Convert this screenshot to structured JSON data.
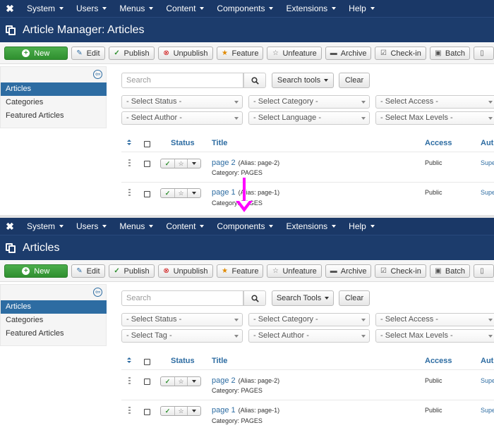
{
  "nav": {
    "items": [
      "System",
      "Users",
      "Menus",
      "Content",
      "Components",
      "Extensions",
      "Help"
    ]
  },
  "top": {
    "title": "Article Manager: Articles",
    "search": {
      "placeholder": "Search",
      "tools_label": "Search tools",
      "clear_label": "Clear"
    },
    "filters": [
      "- Select Status -",
      "- Select Category -",
      "- Select Access -",
      "- Select Author -",
      "- Select Language -",
      "- Select Max Levels -"
    ]
  },
  "bottom": {
    "title": "Articles",
    "search": {
      "placeholder": "Search",
      "tools_label": "Search Tools",
      "clear_label": "Clear"
    },
    "filters": [
      "- Select Status -",
      "- Select Category -",
      "- Select Access -",
      "- Select Tag -",
      "- Select Author -",
      "- Select Max Levels -"
    ]
  },
  "toolbar": {
    "new": "New",
    "edit": "Edit",
    "publish": "Publish",
    "unpublish": "Unpublish",
    "feature": "Feature",
    "unfeature": "Unfeature",
    "archive": "Archive",
    "checkin": "Check-in",
    "batch": "Batch"
  },
  "sidebar": {
    "items": [
      "Articles",
      "Categories",
      "Featured Articles"
    ]
  },
  "table": {
    "headers": {
      "status": "Status",
      "title": "Title",
      "access": "Access",
      "author": "Aut"
    },
    "rows": [
      {
        "title": "page 2",
        "alias": "(Alias: page-2)",
        "category": "Category: PAGES",
        "access": "Public",
        "author": "Supe"
      },
      {
        "title": "page 1",
        "alias": "(Alias: page-1)",
        "category": "Category: PAGES",
        "access": "Public",
        "author": "Supe"
      }
    ]
  },
  "colors": {
    "nav_bg": "#1a3867",
    "title_bg": "#1c3c6c",
    "new_button": "#3a9a3a",
    "link": "#2d6ca2",
    "active_sidebar": "#2d6ca2",
    "arrow": "#ff00ff"
  }
}
